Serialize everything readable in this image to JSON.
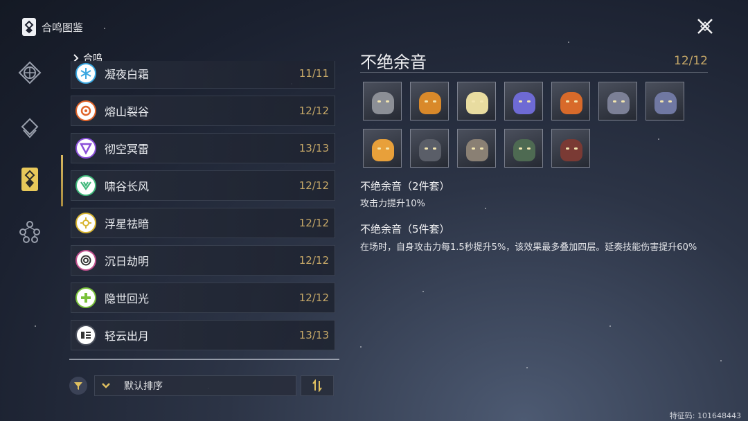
{
  "header": {
    "title": "合鸣图鉴",
    "logo_icon": "sonata-book-icon",
    "close_icon": "close-x-icon"
  },
  "rail": {
    "items": [
      {
        "icon": "sigil-icon",
        "active": false
      },
      {
        "icon": "echo-layers-icon",
        "active": false
      },
      {
        "icon": "sonata-icon",
        "active": true
      },
      {
        "icon": "network-icon",
        "active": false
      }
    ]
  },
  "list": {
    "header": "合鸣",
    "items": [
      {
        "name": "凝夜白霜",
        "count": "11/11",
        "icon": "glacio-icon",
        "color": "#3aa7e0"
      },
      {
        "name": "熔山裂谷",
        "count": "12/12",
        "icon": "fusion-icon",
        "color": "#e0642a"
      },
      {
        "name": "彻空冥雷",
        "count": "13/13",
        "icon": "electro-icon",
        "color": "#8a4fd8"
      },
      {
        "name": "啸谷长风",
        "count": "12/12",
        "icon": "aero-icon",
        "color": "#3fb87a"
      },
      {
        "name": "浮星祛暗",
        "count": "12/12",
        "icon": "spectro-icon",
        "color": "#d8b530"
      },
      {
        "name": "沉日劫明",
        "count": "12/12",
        "icon": "havoc-icon",
        "color": "#c2508e"
      },
      {
        "name": "隐世回光",
        "count": "12/12",
        "icon": "healing-icon",
        "color": "#7ac23a"
      },
      {
        "name": "轻云出月",
        "count": "13/13",
        "icon": "moonlit-icon",
        "color": "#4a4f5c"
      }
    ]
  },
  "filter": {
    "filter_icon": "filter-icon",
    "sort_label": "默认排序",
    "sort_chevron": "chevron-down-icon",
    "sort_order_icon": "sort-order-icon"
  },
  "detail": {
    "title": "不绝余音",
    "count": "12/12",
    "portraits": [
      {
        "name": "echo-portrait-1",
        "color": "#8c8f96"
      },
      {
        "name": "echo-portrait-2",
        "color": "#d9892a"
      },
      {
        "name": "echo-portrait-3",
        "color": "#e8dca0"
      },
      {
        "name": "echo-portrait-4",
        "color": "#6e6ad4"
      },
      {
        "name": "echo-portrait-5",
        "color": "#d86a2a"
      },
      {
        "name": "echo-portrait-6",
        "color": "#7c8096"
      },
      {
        "name": "echo-portrait-7",
        "color": "#7078a2"
      },
      {
        "name": "echo-portrait-8",
        "color": "#e8a03a"
      },
      {
        "name": "echo-portrait-9",
        "color": "#5a5e68"
      },
      {
        "name": "echo-portrait-10",
        "color": "#8a8074"
      },
      {
        "name": "echo-portrait-11",
        "color": "#4e6a52"
      },
      {
        "name": "echo-portrait-12",
        "color": "#7a3a34"
      }
    ],
    "set2_title": "不绝余音（2件套）",
    "set2_desc": "攻击力提升10%",
    "set5_title": "不绝余音（5件套）",
    "set5_desc": "在场时，自身攻击力每1.5秒提升5%，该效果最多叠加四层。延奏技能伤害提升60%"
  },
  "watermark": "特征码: 101648443",
  "colors": {
    "accent_gold": "#c6a868",
    "text": "#e8e8ec"
  }
}
